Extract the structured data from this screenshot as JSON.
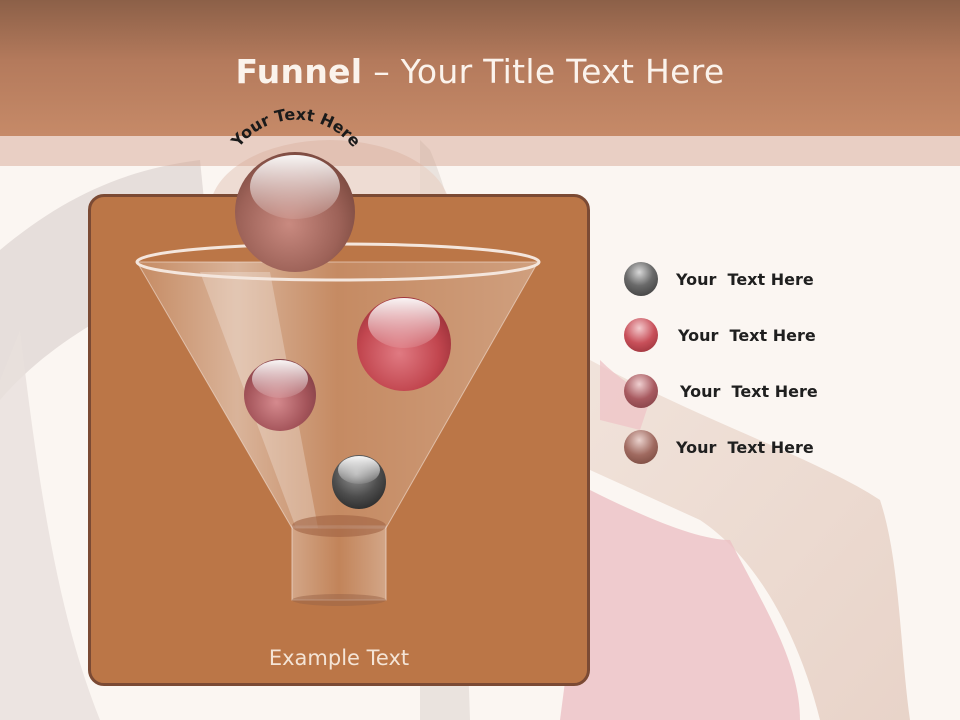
{
  "slide": {
    "title_bold": "Funnel",
    "title_rest": " – Your Title Text Here",
    "arc_text": "Your Text Here",
    "example_text": "Example Text"
  },
  "legend": [
    {
      "label": "Your  Text Here",
      "color": "#4a4a4a"
    },
    {
      "label": "Your  Text Here",
      "color": "#c0444c"
    },
    {
      "label": "Your  Text Here",
      "color": "#a8575c"
    },
    {
      "label": "Your  Text Here",
      "color": "#9a6a5e"
    }
  ]
}
